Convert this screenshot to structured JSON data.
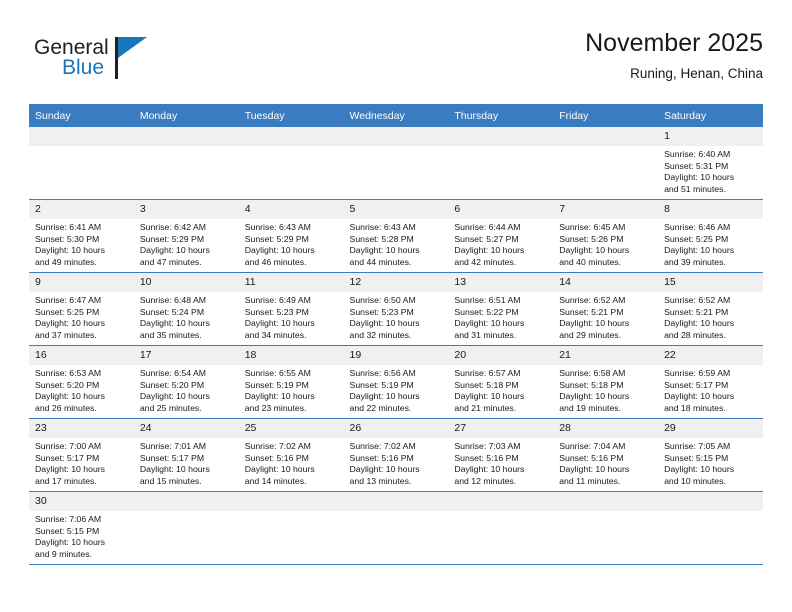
{
  "brand": {
    "line1": "General",
    "line2": "Blue",
    "accent_color": "#1b75bb"
  },
  "header": {
    "title": "November 2025",
    "location": "Runing, Henan, China"
  },
  "calendar": {
    "header_color": "#3a7cc0",
    "weekdays": [
      "Sunday",
      "Monday",
      "Tuesday",
      "Wednesday",
      "Thursday",
      "Friday",
      "Saturday"
    ],
    "weeks": [
      [
        {
          "day": "",
          "sunrise": "",
          "sunset": "",
          "daylight1": "",
          "daylight2": ""
        },
        {
          "day": "",
          "sunrise": "",
          "sunset": "",
          "daylight1": "",
          "daylight2": ""
        },
        {
          "day": "",
          "sunrise": "",
          "sunset": "",
          "daylight1": "",
          "daylight2": ""
        },
        {
          "day": "",
          "sunrise": "",
          "sunset": "",
          "daylight1": "",
          "daylight2": ""
        },
        {
          "day": "",
          "sunrise": "",
          "sunset": "",
          "daylight1": "",
          "daylight2": ""
        },
        {
          "day": "",
          "sunrise": "",
          "sunset": "",
          "daylight1": "",
          "daylight2": ""
        },
        {
          "day": "1",
          "sunrise": "Sunrise: 6:40 AM",
          "sunset": "Sunset: 5:31 PM",
          "daylight1": "Daylight: 10 hours",
          "daylight2": "and 51 minutes."
        }
      ],
      [
        {
          "day": "2",
          "sunrise": "Sunrise: 6:41 AM",
          "sunset": "Sunset: 5:30 PM",
          "daylight1": "Daylight: 10 hours",
          "daylight2": "and 49 minutes."
        },
        {
          "day": "3",
          "sunrise": "Sunrise: 6:42 AM",
          "sunset": "Sunset: 5:29 PM",
          "daylight1": "Daylight: 10 hours",
          "daylight2": "and 47 minutes."
        },
        {
          "day": "4",
          "sunrise": "Sunrise: 6:43 AM",
          "sunset": "Sunset: 5:29 PM",
          "daylight1": "Daylight: 10 hours",
          "daylight2": "and 46 minutes."
        },
        {
          "day": "5",
          "sunrise": "Sunrise: 6:43 AM",
          "sunset": "Sunset: 5:28 PM",
          "daylight1": "Daylight: 10 hours",
          "daylight2": "and 44 minutes."
        },
        {
          "day": "6",
          "sunrise": "Sunrise: 6:44 AM",
          "sunset": "Sunset: 5:27 PM",
          "daylight1": "Daylight: 10 hours",
          "daylight2": "and 42 minutes."
        },
        {
          "day": "7",
          "sunrise": "Sunrise: 6:45 AM",
          "sunset": "Sunset: 5:26 PM",
          "daylight1": "Daylight: 10 hours",
          "daylight2": "and 40 minutes."
        },
        {
          "day": "8",
          "sunrise": "Sunrise: 6:46 AM",
          "sunset": "Sunset: 5:25 PM",
          "daylight1": "Daylight: 10 hours",
          "daylight2": "and 39 minutes."
        }
      ],
      [
        {
          "day": "9",
          "sunrise": "Sunrise: 6:47 AM",
          "sunset": "Sunset: 5:25 PM",
          "daylight1": "Daylight: 10 hours",
          "daylight2": "and 37 minutes."
        },
        {
          "day": "10",
          "sunrise": "Sunrise: 6:48 AM",
          "sunset": "Sunset: 5:24 PM",
          "daylight1": "Daylight: 10 hours",
          "daylight2": "and 35 minutes."
        },
        {
          "day": "11",
          "sunrise": "Sunrise: 6:49 AM",
          "sunset": "Sunset: 5:23 PM",
          "daylight1": "Daylight: 10 hours",
          "daylight2": "and 34 minutes."
        },
        {
          "day": "12",
          "sunrise": "Sunrise: 6:50 AM",
          "sunset": "Sunset: 5:23 PM",
          "daylight1": "Daylight: 10 hours",
          "daylight2": "and 32 minutes."
        },
        {
          "day": "13",
          "sunrise": "Sunrise: 6:51 AM",
          "sunset": "Sunset: 5:22 PM",
          "daylight1": "Daylight: 10 hours",
          "daylight2": "and 31 minutes."
        },
        {
          "day": "14",
          "sunrise": "Sunrise: 6:52 AM",
          "sunset": "Sunset: 5:21 PM",
          "daylight1": "Daylight: 10 hours",
          "daylight2": "and 29 minutes."
        },
        {
          "day": "15",
          "sunrise": "Sunrise: 6:52 AM",
          "sunset": "Sunset: 5:21 PM",
          "daylight1": "Daylight: 10 hours",
          "daylight2": "and 28 minutes."
        }
      ],
      [
        {
          "day": "16",
          "sunrise": "Sunrise: 6:53 AM",
          "sunset": "Sunset: 5:20 PM",
          "daylight1": "Daylight: 10 hours",
          "daylight2": "and 26 minutes."
        },
        {
          "day": "17",
          "sunrise": "Sunrise: 6:54 AM",
          "sunset": "Sunset: 5:20 PM",
          "daylight1": "Daylight: 10 hours",
          "daylight2": "and 25 minutes."
        },
        {
          "day": "18",
          "sunrise": "Sunrise: 6:55 AM",
          "sunset": "Sunset: 5:19 PM",
          "daylight1": "Daylight: 10 hours",
          "daylight2": "and 23 minutes."
        },
        {
          "day": "19",
          "sunrise": "Sunrise: 6:56 AM",
          "sunset": "Sunset: 5:19 PM",
          "daylight1": "Daylight: 10 hours",
          "daylight2": "and 22 minutes."
        },
        {
          "day": "20",
          "sunrise": "Sunrise: 6:57 AM",
          "sunset": "Sunset: 5:18 PM",
          "daylight1": "Daylight: 10 hours",
          "daylight2": "and 21 minutes."
        },
        {
          "day": "21",
          "sunrise": "Sunrise: 6:58 AM",
          "sunset": "Sunset: 5:18 PM",
          "daylight1": "Daylight: 10 hours",
          "daylight2": "and 19 minutes."
        },
        {
          "day": "22",
          "sunrise": "Sunrise: 6:59 AM",
          "sunset": "Sunset: 5:17 PM",
          "daylight1": "Daylight: 10 hours",
          "daylight2": "and 18 minutes."
        }
      ],
      [
        {
          "day": "23",
          "sunrise": "Sunrise: 7:00 AM",
          "sunset": "Sunset: 5:17 PM",
          "daylight1": "Daylight: 10 hours",
          "daylight2": "and 17 minutes."
        },
        {
          "day": "24",
          "sunrise": "Sunrise: 7:01 AM",
          "sunset": "Sunset: 5:17 PM",
          "daylight1": "Daylight: 10 hours",
          "daylight2": "and 15 minutes."
        },
        {
          "day": "25",
          "sunrise": "Sunrise: 7:02 AM",
          "sunset": "Sunset: 5:16 PM",
          "daylight1": "Daylight: 10 hours",
          "daylight2": "and 14 minutes."
        },
        {
          "day": "26",
          "sunrise": "Sunrise: 7:02 AM",
          "sunset": "Sunset: 5:16 PM",
          "daylight1": "Daylight: 10 hours",
          "daylight2": "and 13 minutes."
        },
        {
          "day": "27",
          "sunrise": "Sunrise: 7:03 AM",
          "sunset": "Sunset: 5:16 PM",
          "daylight1": "Daylight: 10 hours",
          "daylight2": "and 12 minutes."
        },
        {
          "day": "28",
          "sunrise": "Sunrise: 7:04 AM",
          "sunset": "Sunset: 5:16 PM",
          "daylight1": "Daylight: 10 hours",
          "daylight2": "and 11 minutes."
        },
        {
          "day": "29",
          "sunrise": "Sunrise: 7:05 AM",
          "sunset": "Sunset: 5:15 PM",
          "daylight1": "Daylight: 10 hours",
          "daylight2": "and 10 minutes."
        }
      ],
      [
        {
          "day": "30",
          "sunrise": "Sunrise: 7:06 AM",
          "sunset": "Sunset: 5:15 PM",
          "daylight1": "Daylight: 10 hours",
          "daylight2": "and 9 minutes."
        },
        {
          "day": "",
          "sunrise": "",
          "sunset": "",
          "daylight1": "",
          "daylight2": ""
        },
        {
          "day": "",
          "sunrise": "",
          "sunset": "",
          "daylight1": "",
          "daylight2": ""
        },
        {
          "day": "",
          "sunrise": "",
          "sunset": "",
          "daylight1": "",
          "daylight2": ""
        },
        {
          "day": "",
          "sunrise": "",
          "sunset": "",
          "daylight1": "",
          "daylight2": ""
        },
        {
          "day": "",
          "sunrise": "",
          "sunset": "",
          "daylight1": "",
          "daylight2": ""
        },
        {
          "day": "",
          "sunrise": "",
          "sunset": "",
          "daylight1": "",
          "daylight2": ""
        }
      ]
    ]
  }
}
